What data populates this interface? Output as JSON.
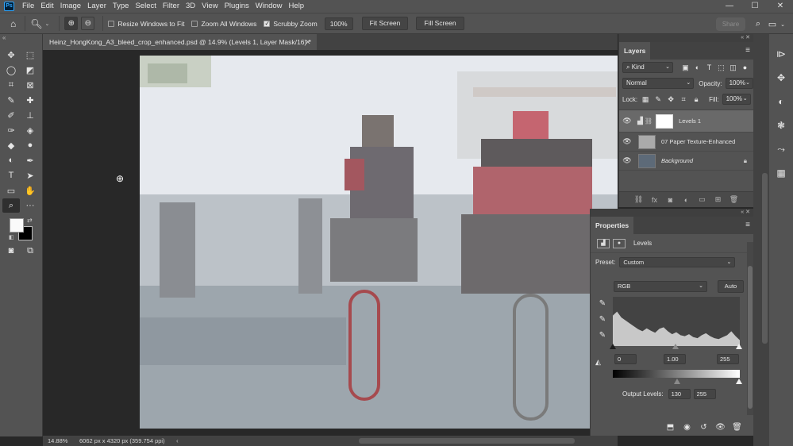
{
  "menu": {
    "logo": "Ps",
    "items": [
      "File",
      "Edit",
      "Image",
      "Layer",
      "Type",
      "Select",
      "Filter",
      "3D",
      "View",
      "Plugins",
      "Window",
      "Help"
    ]
  },
  "window_controls": [
    "—",
    "☐",
    "✕"
  ],
  "options": {
    "resize_windows_label": "Resize Windows to Fit",
    "resize_windows_checked": false,
    "zoom_all_label": "Zoom All Windows",
    "zoom_all_checked": false,
    "scrubby_label": "Scrubby Zoom",
    "scrubby_checked": true,
    "zoom_value": "100%",
    "fit_screen_label": "Fit Screen",
    "fill_screen_label": "Fill Screen",
    "share_label": "Share"
  },
  "document": {
    "tab_title": "Heinz_HongKong_A3_bleed_crop_enhanced.psd @ 14.9% (Levels 1, Layer Mask/16) *",
    "zoom": "14.88%",
    "doc_info": "6062 px x 4320 px (359.754 ppi)"
  },
  "layers_panel": {
    "title": "Layers",
    "filter_kind": "Kind",
    "blend_mode": "Normal",
    "opacity_label": "Opacity:",
    "opacity_value": "100%",
    "lock_label": "Lock:",
    "fill_label": "Fill:",
    "fill_value": "100%",
    "layers": [
      {
        "name": "Levels 1",
        "visible": true,
        "selected": true
      },
      {
        "name": "07 Paper Texture-Enhanced",
        "visible": true,
        "selected": false
      },
      {
        "name": "Background",
        "visible": true,
        "selected": false,
        "locked": true
      }
    ]
  },
  "properties_panel": {
    "title": "Properties",
    "adjustment_name": "Levels",
    "preset_label": "Preset:",
    "preset_value": "Custom",
    "channel": "RGB",
    "auto_label": "Auto",
    "input_black": "0",
    "input_gamma": "1.00",
    "input_white": "255",
    "output_label": "Output Levels:",
    "output_black": "130",
    "output_white": "255",
    "histogram_levels": [
      0.62,
      0.7,
      0.58,
      0.52,
      0.46,
      0.4,
      0.34,
      0.3,
      0.36,
      0.31,
      0.27,
      0.35,
      0.38,
      0.3,
      0.24,
      0.28,
      0.22,
      0.2,
      0.24,
      0.18,
      0.16,
      0.22,
      0.26,
      0.2,
      0.16,
      0.14,
      0.18,
      0.22,
      0.3,
      0.2,
      0.12
    ]
  },
  "icons": {
    "tools": [
      "move-icon",
      "marquee-icon",
      "lasso-icon",
      "object-select-icon",
      "crop-icon",
      "frame-icon",
      "eyedropper-icon",
      "healing-icon",
      "brush-icon",
      "stamp-icon",
      "history-brush-icon",
      "eraser-icon",
      "bucket-icon",
      "blur-icon",
      "dodge-icon",
      "pen-icon",
      "type-icon",
      "path-select-icon",
      "rectangle-icon",
      "hand-icon",
      "zoom-icon",
      "more-icon",
      "quickmask-icon",
      "screenmode-icon"
    ]
  },
  "colors": {
    "foreground": "#fafafa",
    "background": "#000000",
    "panel": "#535353",
    "canvas_bg": "#282828"
  }
}
